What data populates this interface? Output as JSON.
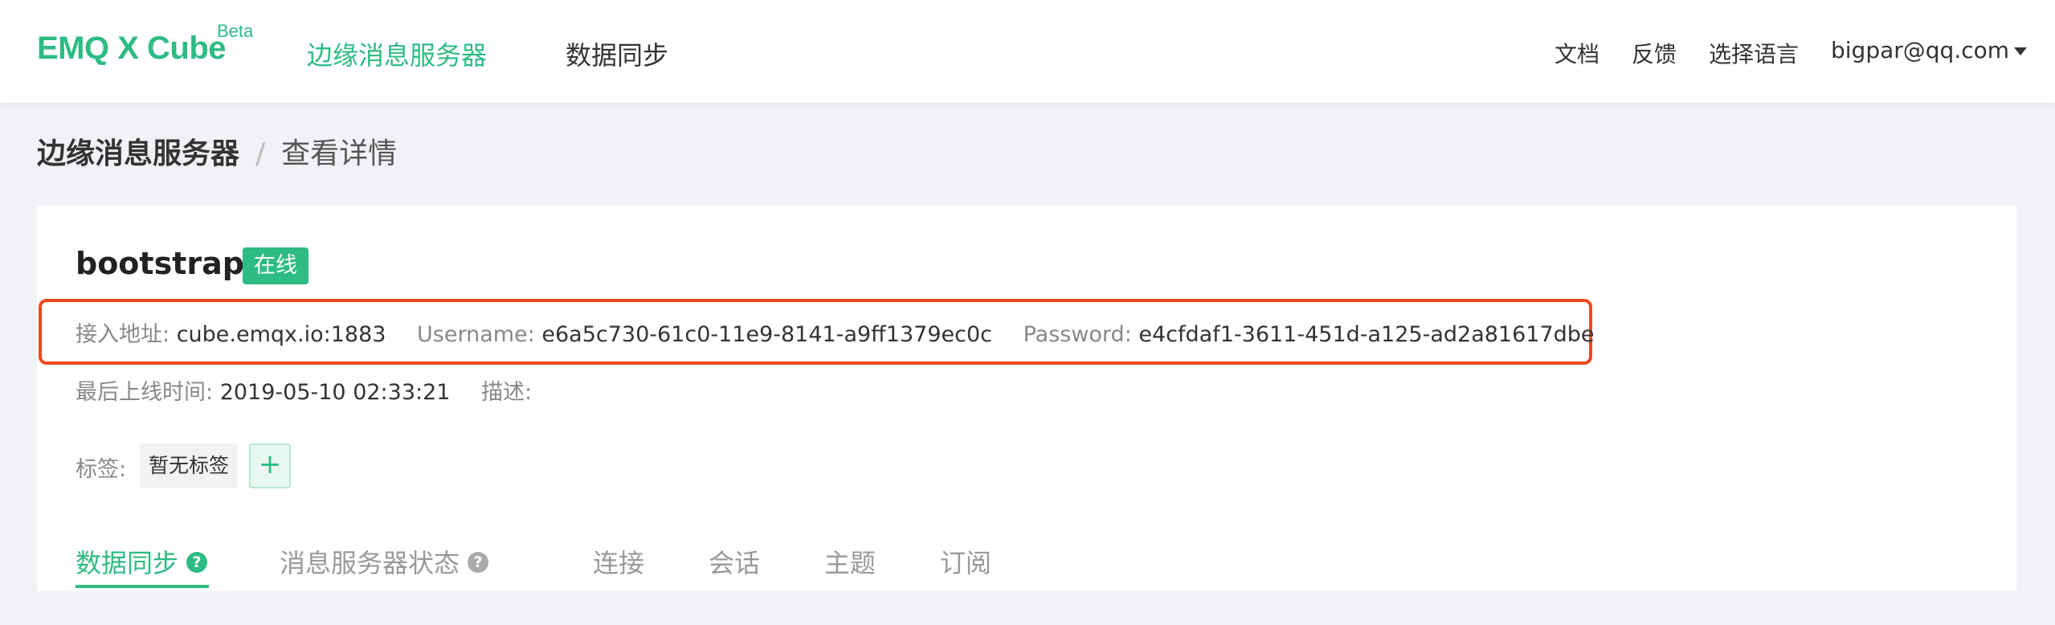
{
  "header": {
    "logo": "EMQ X Cube",
    "beta": "Beta",
    "nav": [
      {
        "label": "边缘消息服务器"
      },
      {
        "label": "数据同步"
      }
    ],
    "right": {
      "docs": "文档",
      "feedback": "反馈",
      "language": "选择语言",
      "user": "bigpar@qq.com"
    }
  },
  "breadcrumb": {
    "parent": "边缘消息服务器",
    "separator": "/",
    "current": "查看详情"
  },
  "detail": {
    "name": "bootstrap",
    "status": "在线",
    "access_label": "接入地址:",
    "access_value": "cube.emqx.io:1883",
    "username_label": "Username:",
    "username_value": "e6a5c730-61c0-11e9-8141-a9ff1379ec0c",
    "password_label": "Password:",
    "password_value": "e4cfdaf1-3611-451d-a125-ad2a81617dbe",
    "last_online_label": "最后上线时间:",
    "last_online_value": "2019-05-10 02:33:21",
    "desc_label": "描述:",
    "tags_label": "标签:",
    "tag_empty": "暂无标签",
    "add_tag": "+"
  },
  "tabs": [
    {
      "label": "数据同步",
      "help": "?"
    },
    {
      "label": "消息服务器状态",
      "help": "?"
    },
    {
      "label": "连接"
    },
    {
      "label": "会话"
    },
    {
      "label": "主题"
    },
    {
      "label": "订阅"
    }
  ],
  "colors": {
    "accent": "#2ebb84",
    "highlight_border": "#ec4a1d"
  }
}
